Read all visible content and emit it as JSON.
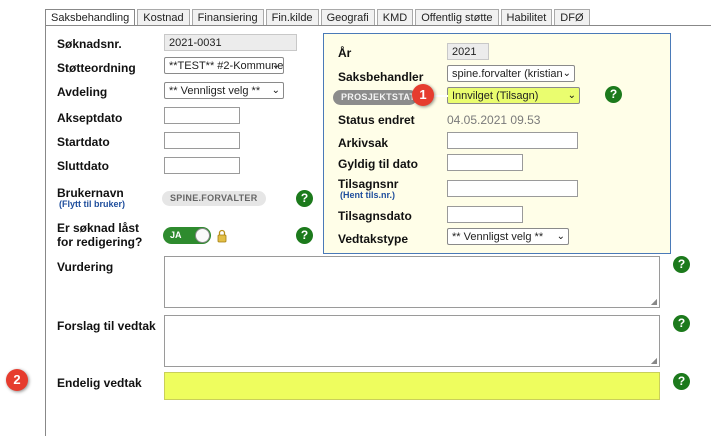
{
  "tabs": [
    "Saksbehandling",
    "Kostnad",
    "Finansiering",
    "Fin.kilde",
    "Geografi",
    "KMD",
    "Offentlig støtte",
    "Habilitet",
    "DFØ"
  ],
  "left": {
    "soknadsnr_label": "Søknadsnr.",
    "soknadsnr_value": "2021-0031",
    "stotteordning_label": "Støtteordning",
    "stotteordning_value": "**TEST** #2-Kommune",
    "avdeling_label": "Avdeling",
    "avdeling_value": "** Vennligst velg **",
    "akseptdato_label": "Akseptdato",
    "startdato_label": "Startdato",
    "sluttdato_label": "Sluttdato",
    "brukernavn_label": "Brukernavn",
    "brukernavn_link": "(Flytt til bruker)",
    "brukernavn_value": "SPINE.FORVALTER",
    "laast_label_1": "Er søknad låst",
    "laast_label_2": "for redigering?",
    "laast_value": "JA"
  },
  "right": {
    "ar_label": "År",
    "ar_value": "2021",
    "saksbehandler_label": "Saksbehandler",
    "saksbehandler_value": "spine.forvalter (kristian",
    "prosjektstatus_label": "PROSJEKTSTATUS",
    "prosjektstatus_value": "Innvilget (Tilsagn)",
    "status_endret_label": "Status endret",
    "status_endret_value": "04.05.2021 09.53",
    "arkivsak_label": "Arkivsak",
    "gyldig_label": "Gyldig til dato",
    "tilsagnsnr_label": "Tilsagnsnr",
    "tilsagnsnr_link": "(Hent tils.nr.)",
    "tilsagnsdato_label": "Tilsagnsdato",
    "vedtakstype_label": "Vedtakstype",
    "vedtakstype_value": "** Vennligst velg **"
  },
  "bottom": {
    "vurdering_label": "Vurdering",
    "forslag_label": "Forslag til vedtak",
    "endelig_label": "Endelig vedtak"
  },
  "help_glyph": "?",
  "callouts": [
    "1",
    "2"
  ],
  "colors": {
    "highlight": "#eefd5e",
    "help": "#1c7a1c",
    "callout": "#e63c2e",
    "box_bg": "#fffee8",
    "box_border": "#4a7ab8"
  }
}
